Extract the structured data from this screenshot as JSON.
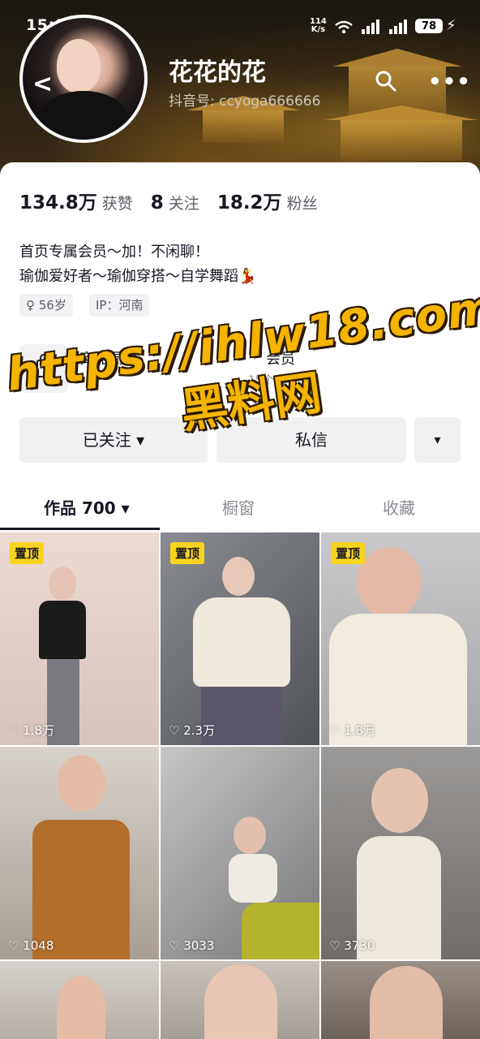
{
  "status": {
    "time": "15:02",
    "bluetooth_icon": "bluetooth-icon",
    "net_speed_value": "114",
    "net_speed_unit": "K/s",
    "battery": "78"
  },
  "profile": {
    "nickname": "花花的花",
    "douyin_id": "抖音号: ccyoga666666",
    "stats": {
      "likes_value": "134.8万",
      "likes_label": "获赞",
      "following_value": "8",
      "following_label": "关注",
      "followers_value": "18.2万",
      "followers_label": "粉丝"
    },
    "bio_line1": "首页专属会员～加！不闲聊！",
    "bio_line2": "瑜伽爱好者～瑜伽穿搭～自学舞蹈💃",
    "tags": [
      "♀ 56岁",
      "IP：河南"
    ],
    "shop_label": "商品橱窗",
    "member_label": "会员",
    "member_sub": "15个人"
  },
  "actions": {
    "follow_label": "已关注 ▾",
    "message_label": "私信",
    "more_label": "▾"
  },
  "tabs": {
    "works": "作品 700 ▾",
    "showcase": "橱窗",
    "favorites": "收藏"
  },
  "videos": [
    {
      "pinned": "置顶",
      "likes": "1.8万"
    },
    {
      "pinned": "置顶",
      "likes": "2.3万"
    },
    {
      "pinned": "置顶",
      "likes": "1.8万"
    },
    {
      "pinned": "",
      "likes": "1048"
    },
    {
      "pinned": "",
      "likes": "3033"
    },
    {
      "pinned": "",
      "likes": "3730"
    }
  ],
  "watermark": {
    "line1": "https://ihlw18.com",
    "line2": "黑料网"
  },
  "colors": {
    "accent_yellow": "#f9d41f",
    "watermark": "#f5b400"
  }
}
